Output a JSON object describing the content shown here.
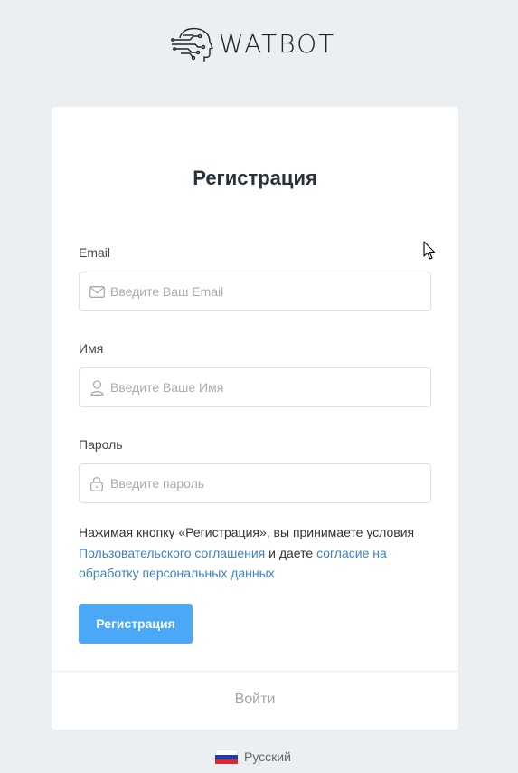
{
  "brand": {
    "logo_text": "WATBOT"
  },
  "form": {
    "title": "Регистрация",
    "email": {
      "label": "Email",
      "placeholder": "Введите Ваш Email",
      "icon": "envelope-icon"
    },
    "name": {
      "label": "Имя",
      "placeholder": "Введите Ваше Имя",
      "icon": "user-icon"
    },
    "password": {
      "label": "Пароль",
      "placeholder": "Введите пароль",
      "icon": "lock-icon"
    },
    "terms": {
      "prefix": "Нажимая кнопку «Регистрация», вы принимаете условия",
      "agreement_link": "Пользовательского соглашения",
      "middle": "и даете",
      "consent_link": "согласие на обработку персональных данных"
    },
    "submit_label": "Регистрация",
    "login_link": "Войти"
  },
  "language": {
    "label": "Русский",
    "flag": "russia-flag-icon"
  },
  "colors": {
    "background": "#eceff1",
    "primary_button": "#4aa8f7",
    "link": "#3d82c4",
    "title": "#263238"
  }
}
